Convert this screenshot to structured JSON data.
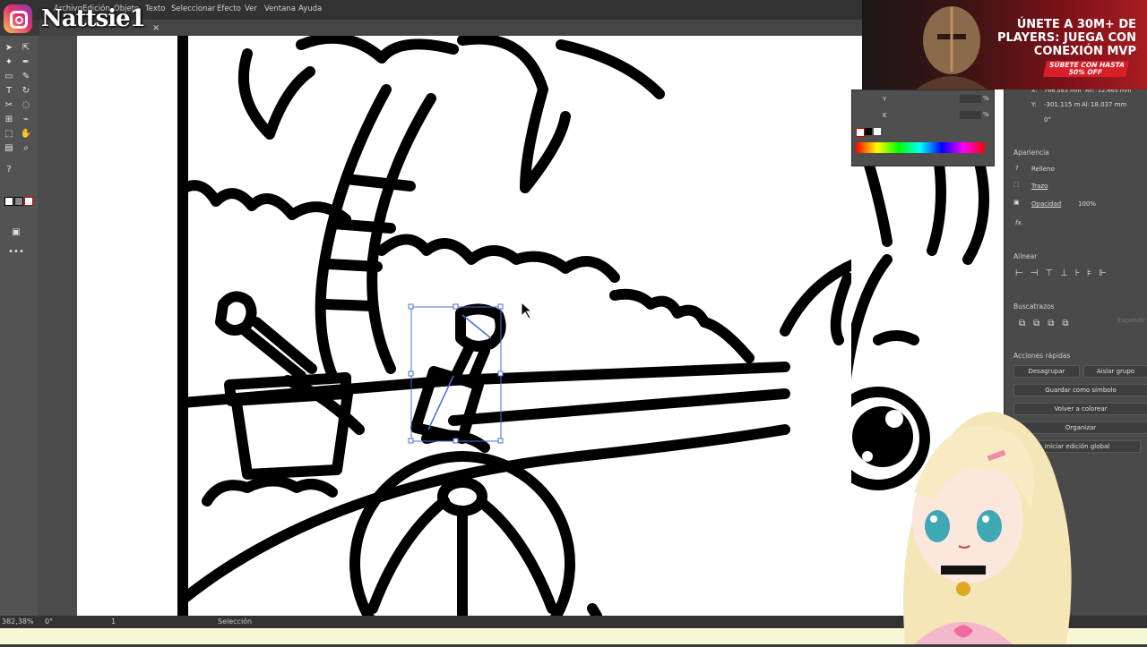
{
  "overlay": {
    "handle": "Nattsie1"
  },
  "menu": [
    "Archivo",
    "Edición",
    "Objeto",
    "Texto",
    "Seleccionar",
    "Efecto",
    "Ver",
    "Ventana",
    "Ayuda"
  ],
  "tab": {
    "close": "×"
  },
  "color_panel": {
    "row_y": "Y",
    "row_k": "K",
    "pct1": "%",
    "pct2": "%"
  },
  "transform": {
    "x_label": "X:",
    "x_value": "766.583 mm",
    "w_label": "An:",
    "w_value": "12.665 mm",
    "y_label": "Y:",
    "y_value": "-301.115 m",
    "h_label": "Al:",
    "h_value": "18.037 mm",
    "angle_value": "0°"
  },
  "appearance": {
    "title": "Apariencia",
    "fill": "Relleno",
    "stroke": "Trazo",
    "opacity": "Opacidad",
    "opacity_value": "100%",
    "fx": "fx."
  },
  "align": {
    "title": "Alinear"
  },
  "pathfinder": {
    "title": "Buscatrazos",
    "expand": "Expandir"
  },
  "quick_actions": {
    "title": "Acciones rápidas",
    "ungroup": "Desagrupar",
    "isolate": "Aislar grupo",
    "save_symbol": "Guardar como símbolo",
    "recolor": "Volver a colorear",
    "arrange": "Organizar",
    "global_edit": "Iniciar edición global"
  },
  "status": {
    "zoom": "382,38%",
    "rotation": "0°",
    "artboard": "1",
    "tool": "Selección"
  },
  "ad": {
    "headline": "ÚNETE A 30M+ DE PLAYERS: JUEGA CON CONEXIÓN MVP",
    "cta": "SÚBETE CON HASTA 50% OFF",
    "accent": "#d81f2a"
  }
}
